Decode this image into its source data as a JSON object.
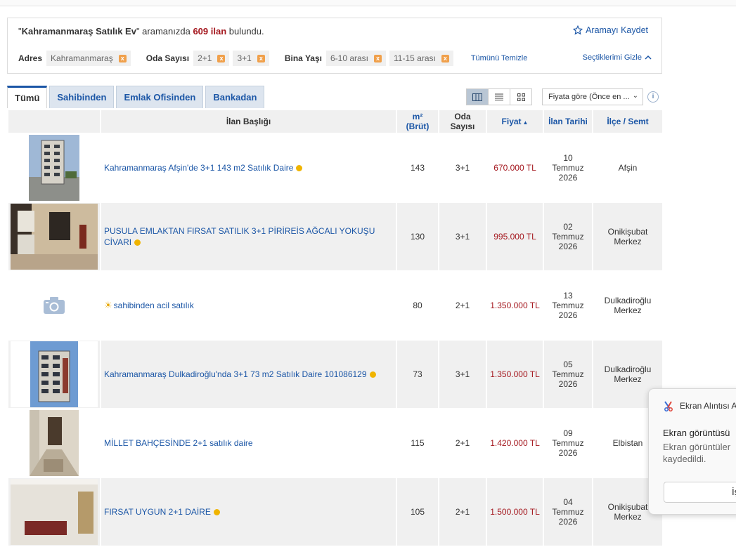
{
  "search": {
    "query": "Kahramanmaraş Satılık Ev",
    "quote_open": "\"",
    "quote_close": "\"",
    "middle_text": " aramanızda ",
    "count": "609 ilan",
    "end_text": " bulundu.",
    "save_label": "Aramayı Kaydet"
  },
  "filters": {
    "address_label": "Adres",
    "address_chips": [
      "Kahramanmaraş"
    ],
    "rooms_label": "Oda Sayısı",
    "rooms_chips": [
      "2+1",
      "3+1"
    ],
    "age_label": "Bina Yaşı",
    "age_chips": [
      "6-10 arası",
      "11-15 arası"
    ],
    "chip_remove": "x",
    "clear_all": "Tümünü Temizle",
    "hide_selected": "Seçtiklerimi Gizle"
  },
  "tabs": [
    {
      "label": "Tümü",
      "active": true
    },
    {
      "label": "Sahibinden",
      "active": false
    },
    {
      "label": "Emlak Ofisinden",
      "active": false
    },
    {
      "label": "Bankadan",
      "active": false
    }
  ],
  "sort": {
    "selected": "Fiyata göre (Önce en ..."
  },
  "info_glyph": "i",
  "table": {
    "headers": {
      "title": "İlan Başlığı",
      "area_top": "m²",
      "area_bottom": "(Brüt)",
      "rooms_top": "Oda",
      "rooms_bottom": "Sayısı",
      "price": "Fiyat",
      "date": "İlan Tarihi",
      "district": "İlçe / Semt"
    },
    "rows": [
      {
        "title": "Kahramanmaraş Afşin'de 3+1 143 m2 Satılık Daire",
        "area": "143",
        "rooms": "3+1",
        "price": "670.000 TL",
        "date": [
          "10",
          "Temmuz",
          "2026"
        ],
        "district": [
          "Afşin"
        ]
      },
      {
        "title": "PUSULA EMLAKTAN FIRSAT SATILIK 3+1 PİRİREİS AĞCALI YOKUŞU CİVARI",
        "area": "130",
        "rooms": "3+1",
        "price": "995.000 TL",
        "date": [
          "02",
          "Temmuz",
          "2026"
        ],
        "district": [
          "Onikişubat",
          "Merkez"
        ]
      },
      {
        "title": "sahibinden acil satılık",
        "area": "80",
        "rooms": "2+1",
        "price": "1.350.000 TL",
        "date": [
          "13",
          "Temmuz",
          "2026"
        ],
        "district": [
          "Dulkadiroğlu",
          "Merkez"
        ]
      },
      {
        "title": "Kahramanmaraş Dulkadiroğlu'nda 3+1 73 m2 Satılık Daire 101086129",
        "area": "73",
        "rooms": "3+1",
        "price": "1.350.000 TL",
        "date": [
          "05",
          "Temmuz",
          "2026"
        ],
        "district": [
          "Dulkadiroğlu",
          "Merkez"
        ]
      },
      {
        "title": "MİLLET BAHÇESİNDE 2+1 satılık daire",
        "area": "115",
        "rooms": "2+1",
        "price": "1.420.000 TL",
        "date": [
          "09",
          "Temmuz",
          "2026"
        ],
        "district": [
          "Elbistan"
        ]
      },
      {
        "title": "FIRSAT UYGUN 2+1 DAİRE",
        "area": "105",
        "rooms": "2+1",
        "price": "1.500.000 TL",
        "date": [
          "04",
          "Temmuz",
          "2026"
        ],
        "district": [
          "Onikişubat",
          "Merkez"
        ]
      }
    ]
  },
  "toast": {
    "app": "Ekran Alıntısı A",
    "title": "Ekran görüntüsü",
    "body_line1": "Ekran görüntüler",
    "body_line2": "kaydedildi.",
    "button": "İş"
  },
  "colors": {
    "link": "#1b56a6",
    "price": "#a4171e",
    "chip_x": "#f0a04b",
    "bullet": "#f0b400"
  }
}
